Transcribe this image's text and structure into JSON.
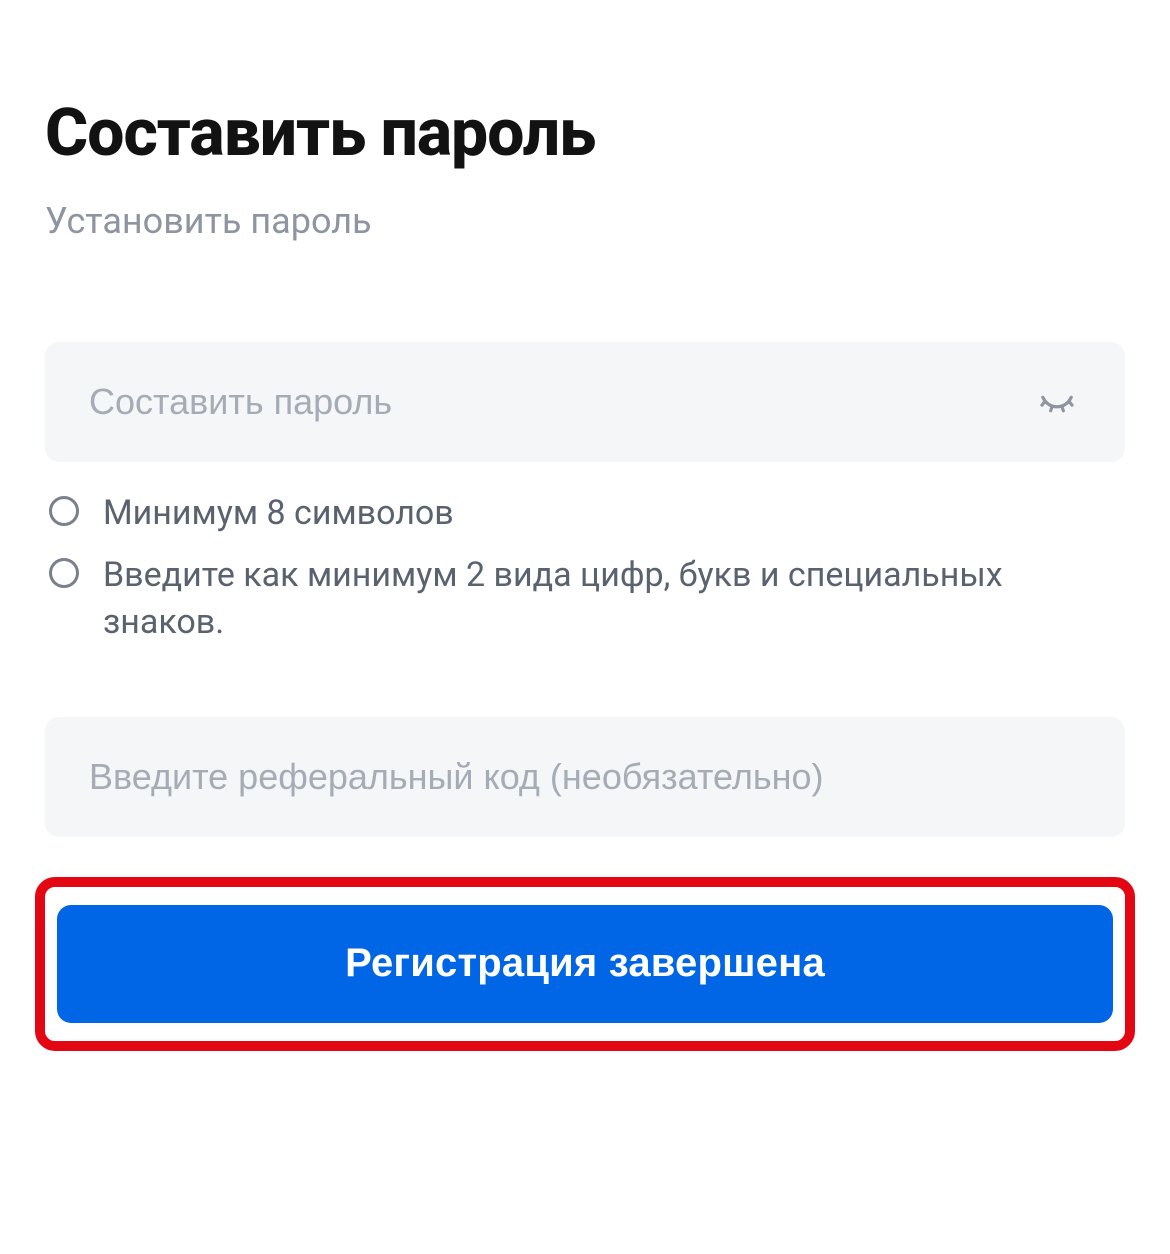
{
  "page": {
    "title": "Составить пароль",
    "subtitle": "Установить пароль"
  },
  "password": {
    "placeholder": "Составить пароль",
    "value": "",
    "eye_icon": "eye-closed-icon"
  },
  "requirements": {
    "items": [
      {
        "text": "Минимум 8 символов"
      },
      {
        "text": "Введите как минимум 2 вида цифр, букв и специальных знаков."
      }
    ]
  },
  "referral": {
    "placeholder": "Введите реферальный код (необязательно)",
    "value": ""
  },
  "actions": {
    "submit_label": "Регистрация завершена"
  },
  "colors": {
    "primary": "#0066e6",
    "highlight_border": "#e30613",
    "text_muted": "#8f95a0",
    "text_body": "#5a6270",
    "input_bg": "#f5f6f8"
  }
}
